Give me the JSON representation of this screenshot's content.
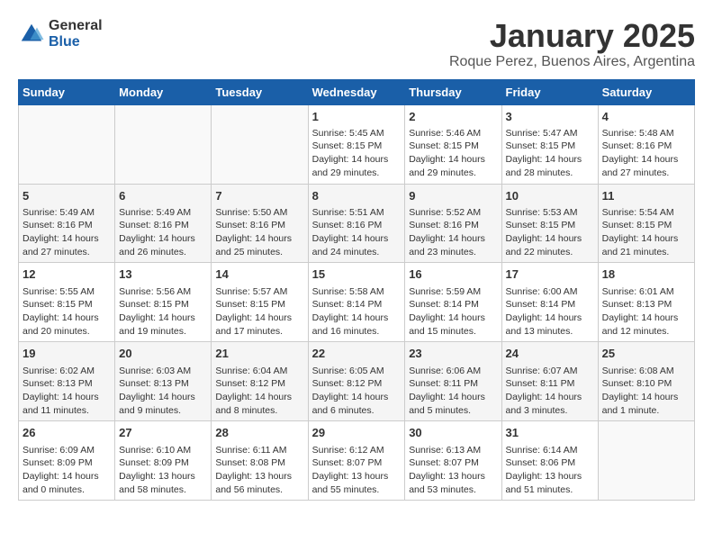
{
  "header": {
    "logo_general": "General",
    "logo_blue": "Blue",
    "month_title": "January 2025",
    "subtitle": "Roque Perez, Buenos Aires, Argentina"
  },
  "weekdays": [
    "Sunday",
    "Monday",
    "Tuesday",
    "Wednesday",
    "Thursday",
    "Friday",
    "Saturday"
  ],
  "weeks": [
    [
      {
        "day": "",
        "content": ""
      },
      {
        "day": "",
        "content": ""
      },
      {
        "day": "",
        "content": ""
      },
      {
        "day": "1",
        "content": "Sunrise: 5:45 AM\nSunset: 8:15 PM\nDaylight: 14 hours and 29 minutes."
      },
      {
        "day": "2",
        "content": "Sunrise: 5:46 AM\nSunset: 8:15 PM\nDaylight: 14 hours and 29 minutes."
      },
      {
        "day": "3",
        "content": "Sunrise: 5:47 AM\nSunset: 8:15 PM\nDaylight: 14 hours and 28 minutes."
      },
      {
        "day": "4",
        "content": "Sunrise: 5:48 AM\nSunset: 8:16 PM\nDaylight: 14 hours and 27 minutes."
      }
    ],
    [
      {
        "day": "5",
        "content": "Sunrise: 5:49 AM\nSunset: 8:16 PM\nDaylight: 14 hours and 27 minutes."
      },
      {
        "day": "6",
        "content": "Sunrise: 5:49 AM\nSunset: 8:16 PM\nDaylight: 14 hours and 26 minutes."
      },
      {
        "day": "7",
        "content": "Sunrise: 5:50 AM\nSunset: 8:16 PM\nDaylight: 14 hours and 25 minutes."
      },
      {
        "day": "8",
        "content": "Sunrise: 5:51 AM\nSunset: 8:16 PM\nDaylight: 14 hours and 24 minutes."
      },
      {
        "day": "9",
        "content": "Sunrise: 5:52 AM\nSunset: 8:16 PM\nDaylight: 14 hours and 23 minutes."
      },
      {
        "day": "10",
        "content": "Sunrise: 5:53 AM\nSunset: 8:15 PM\nDaylight: 14 hours and 22 minutes."
      },
      {
        "day": "11",
        "content": "Sunrise: 5:54 AM\nSunset: 8:15 PM\nDaylight: 14 hours and 21 minutes."
      }
    ],
    [
      {
        "day": "12",
        "content": "Sunrise: 5:55 AM\nSunset: 8:15 PM\nDaylight: 14 hours and 20 minutes."
      },
      {
        "day": "13",
        "content": "Sunrise: 5:56 AM\nSunset: 8:15 PM\nDaylight: 14 hours and 19 minutes."
      },
      {
        "day": "14",
        "content": "Sunrise: 5:57 AM\nSunset: 8:15 PM\nDaylight: 14 hours and 17 minutes."
      },
      {
        "day": "15",
        "content": "Sunrise: 5:58 AM\nSunset: 8:14 PM\nDaylight: 14 hours and 16 minutes."
      },
      {
        "day": "16",
        "content": "Sunrise: 5:59 AM\nSunset: 8:14 PM\nDaylight: 14 hours and 15 minutes."
      },
      {
        "day": "17",
        "content": "Sunrise: 6:00 AM\nSunset: 8:14 PM\nDaylight: 14 hours and 13 minutes."
      },
      {
        "day": "18",
        "content": "Sunrise: 6:01 AM\nSunset: 8:13 PM\nDaylight: 14 hours and 12 minutes."
      }
    ],
    [
      {
        "day": "19",
        "content": "Sunrise: 6:02 AM\nSunset: 8:13 PM\nDaylight: 14 hours and 11 minutes."
      },
      {
        "day": "20",
        "content": "Sunrise: 6:03 AM\nSunset: 8:13 PM\nDaylight: 14 hours and 9 minutes."
      },
      {
        "day": "21",
        "content": "Sunrise: 6:04 AM\nSunset: 8:12 PM\nDaylight: 14 hours and 8 minutes."
      },
      {
        "day": "22",
        "content": "Sunrise: 6:05 AM\nSunset: 8:12 PM\nDaylight: 14 hours and 6 minutes."
      },
      {
        "day": "23",
        "content": "Sunrise: 6:06 AM\nSunset: 8:11 PM\nDaylight: 14 hours and 5 minutes."
      },
      {
        "day": "24",
        "content": "Sunrise: 6:07 AM\nSunset: 8:11 PM\nDaylight: 14 hours and 3 minutes."
      },
      {
        "day": "25",
        "content": "Sunrise: 6:08 AM\nSunset: 8:10 PM\nDaylight: 14 hours and 1 minute."
      }
    ],
    [
      {
        "day": "26",
        "content": "Sunrise: 6:09 AM\nSunset: 8:09 PM\nDaylight: 14 hours and 0 minutes."
      },
      {
        "day": "27",
        "content": "Sunrise: 6:10 AM\nSunset: 8:09 PM\nDaylight: 13 hours and 58 minutes."
      },
      {
        "day": "28",
        "content": "Sunrise: 6:11 AM\nSunset: 8:08 PM\nDaylight: 13 hours and 56 minutes."
      },
      {
        "day": "29",
        "content": "Sunrise: 6:12 AM\nSunset: 8:07 PM\nDaylight: 13 hours and 55 minutes."
      },
      {
        "day": "30",
        "content": "Sunrise: 6:13 AM\nSunset: 8:07 PM\nDaylight: 13 hours and 53 minutes."
      },
      {
        "day": "31",
        "content": "Sunrise: 6:14 AM\nSunset: 8:06 PM\nDaylight: 13 hours and 51 minutes."
      },
      {
        "day": "",
        "content": ""
      }
    ]
  ]
}
